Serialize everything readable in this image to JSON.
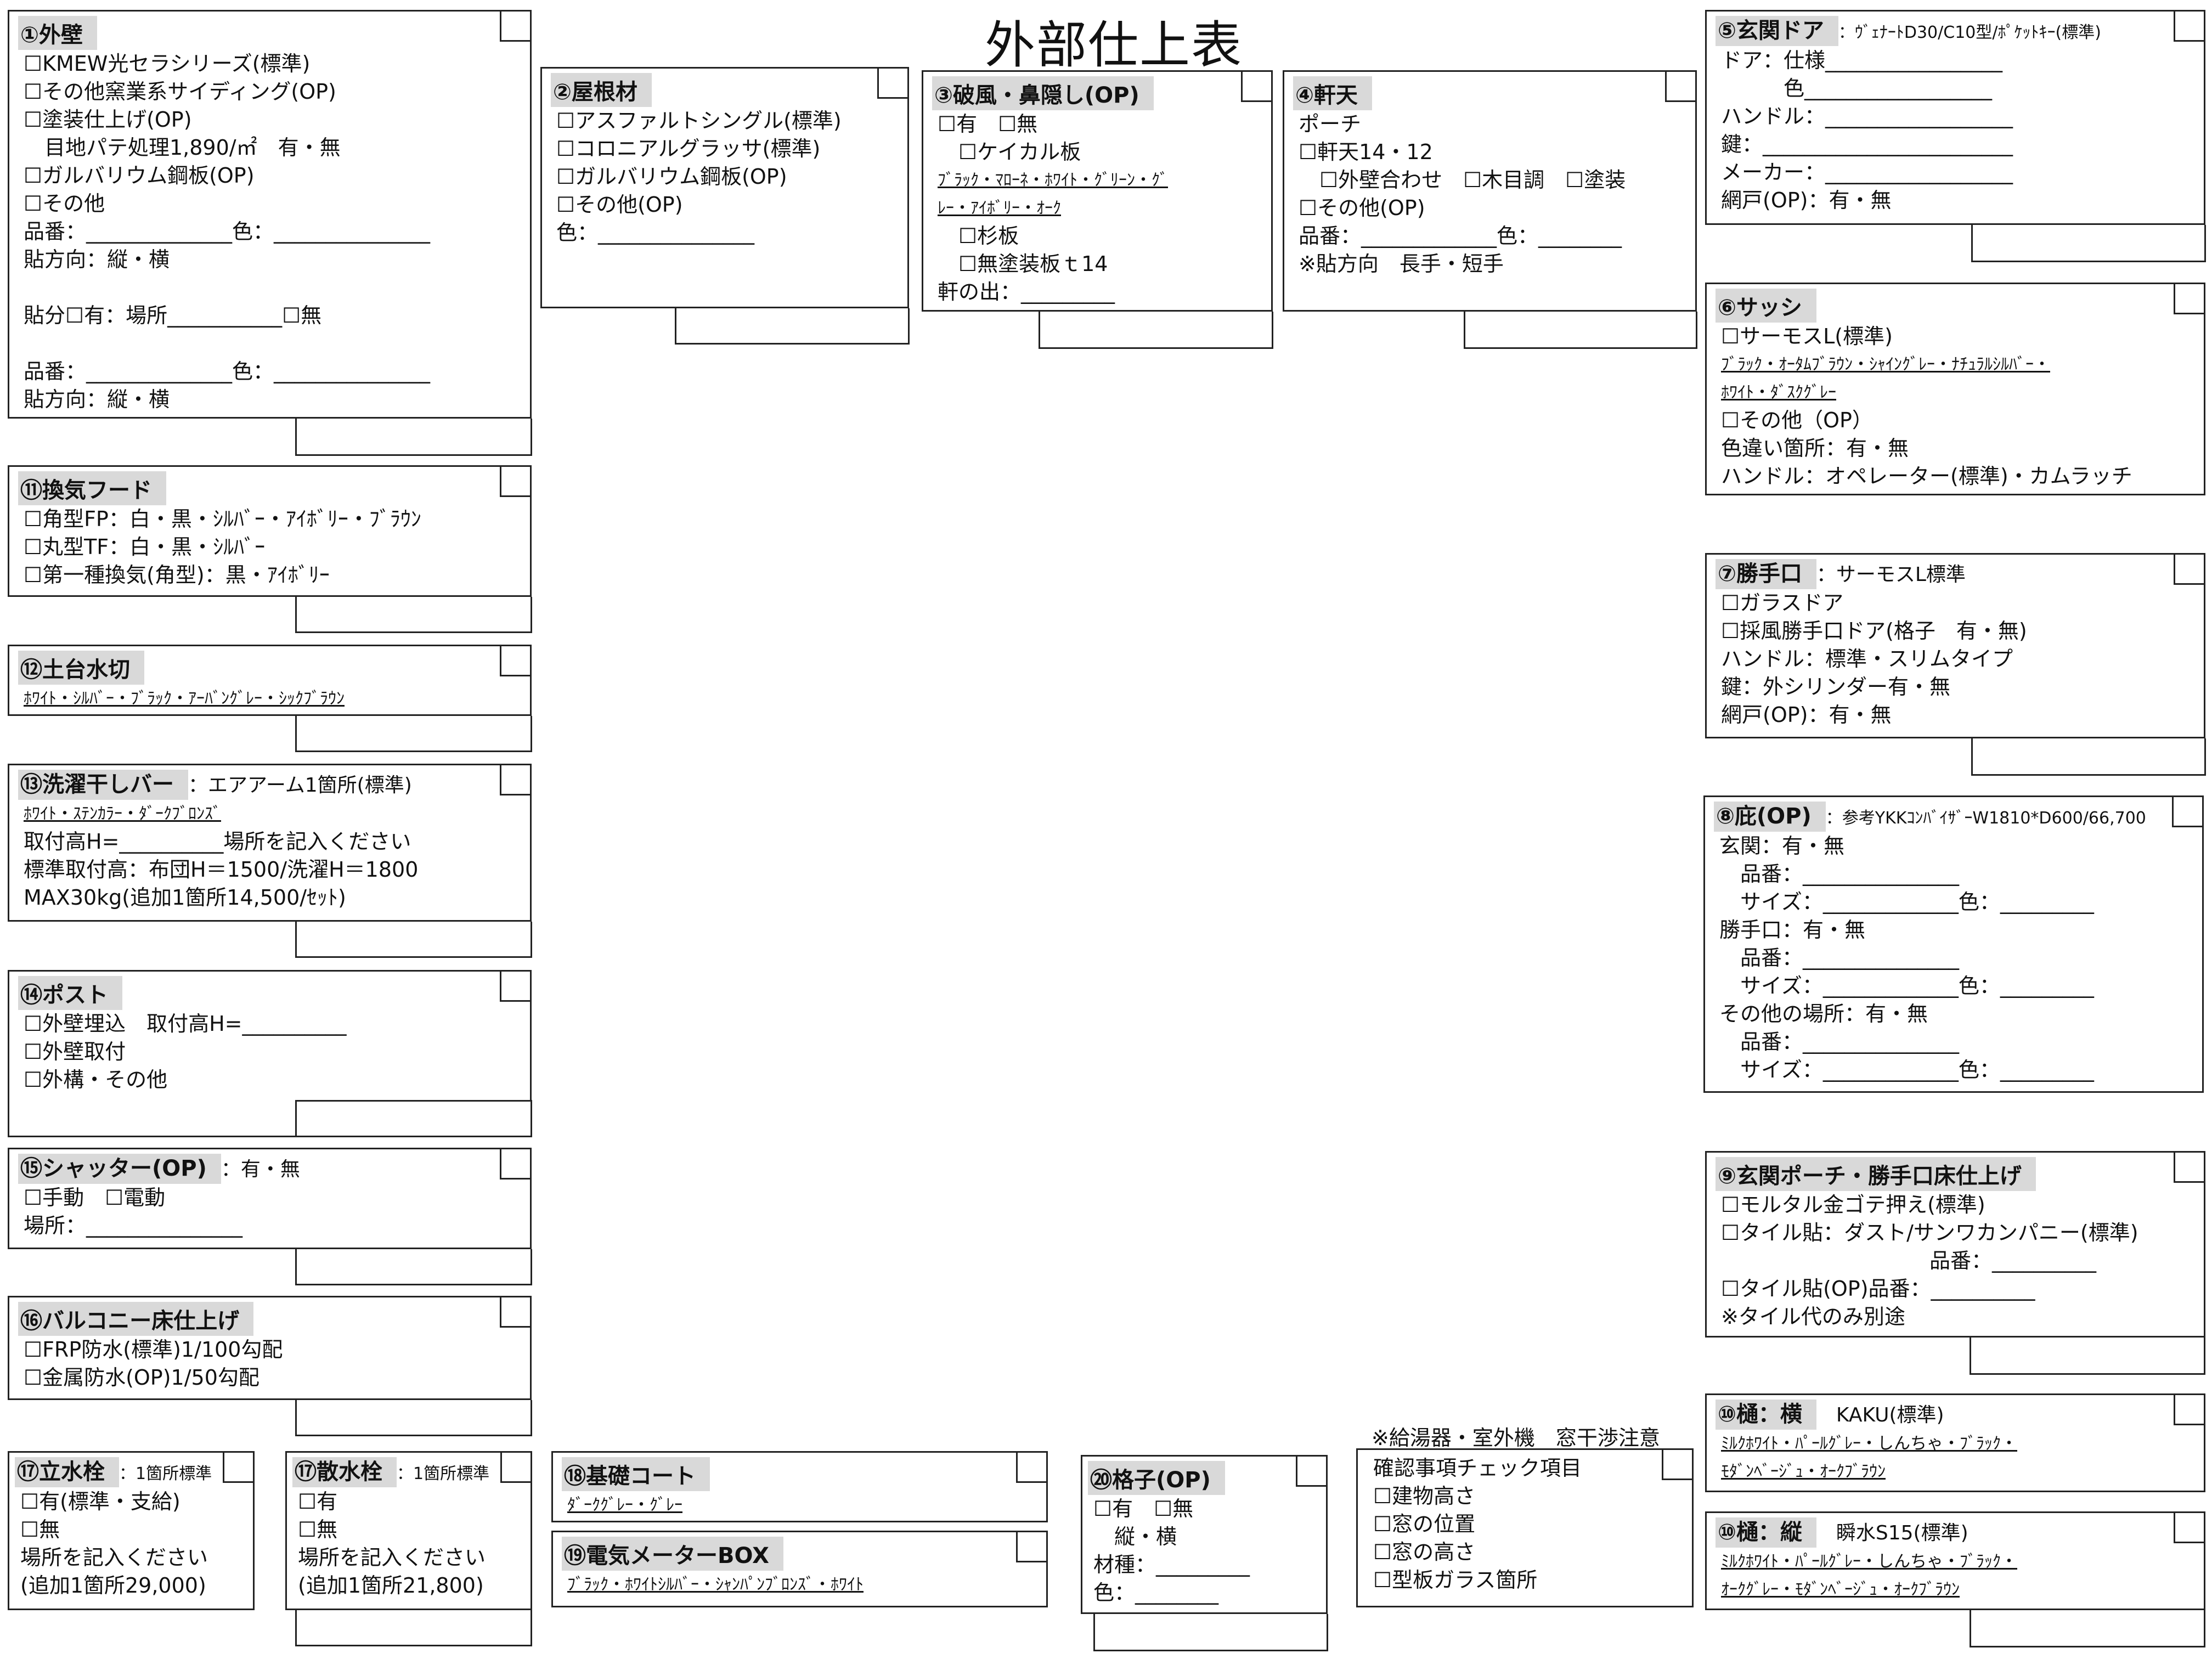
{
  "title": "外部仕上表",
  "note_top": "※給湯器・室外機　窓干渉注意",
  "sections": {
    "s1": {
      "head": "①外壁",
      "lines": [
        "☐KMEW光セラシリーズ(標準)",
        "☐その他窯業系サイディング(OP)",
        "☐塗装仕上げ(OP)",
        "　目地パテ処理1,890/㎡　有・無",
        "☐ガルバリウム鋼板(OP)",
        "☐その他",
        "品番：______________色：_______________",
        "貼方向：縦・横",
        "",
        "貼分☐有：場所___________☐無",
        "",
        "品番：______________色：_______________",
        "貼方向：縦・横"
      ]
    },
    "s2": {
      "head": "②屋根材",
      "lines": [
        "☐アスファルトシングル(標準)",
        "☐コロニアルグラッサ(標準)",
        "☐ガルバリウム鋼板(OP)",
        "☐その他(OP)",
        "色：_______________"
      ]
    },
    "s3": {
      "head": "③破風・鼻隠し(OP)",
      "lines": [
        "☐有　☐無",
        "　☐ケイカル板",
        "ﾌﾞﾗｯｸ・ﾏﾛｰﾈ・ﾎﾜｲﾄ・ｸﾞﾘｰﾝ・ｸﾞ",
        "ﾚｰ・ｱｲﾎﾞﾘｰ・ｵｰｸ",
        "　☐杉板",
        "　☐無塗装板ｔ14",
        "軒の出：_________"
      ]
    },
    "s4": {
      "head": "④軒天",
      "lines": [
        "ポーチ",
        "☐軒天14・12",
        "　☐外壁合わせ　☐木目調　☐塗装",
        "☐その他(OP)",
        "品番：_____________色：________",
        "※貼方向　長手・短手"
      ]
    },
    "s5": {
      "head": "⑤玄関ドア",
      "head_sub": "：ｳﾞｪﾅｰﾄD30/C10型/ﾎﾟｹｯﾄｷｰ(標準)",
      "lines": [
        "ドア：仕様_________________",
        "　　　色__________________",
        "ハンドル：__________________",
        "鍵：________________________",
        "メーカー：__________________",
        "網戸(OP)：有・無"
      ]
    },
    "s6": {
      "head": "⑥サッシ",
      "lines": [
        "☐サーモスL(標準)",
        "ﾌﾞﾗｯｸ・ｵｰﾀﾑﾌﾞﾗｳﾝ・ｼｬｲﾝｸﾞﾚｰ・ﾅﾁｭﾗﾙｼﾙﾊﾞｰ・",
        "ﾎﾜｲﾄ・ﾀﾞｽｸｸﾞﾚｰ",
        "☐その他（OP）",
        "色違い箇所：有・無",
        "ハンドル：オペレーター(標準)・カムラッチ"
      ]
    },
    "s7": {
      "head": "⑦勝手口",
      "head_sub": "：サーモスL標準",
      "lines": [
        "☐ガラスドア",
        "☐採風勝手口ドア(格子　有・無)",
        "ハンドル：標準・スリムタイプ",
        "鍵：外シリンダー有・無",
        "網戸(OP)：有・無"
      ]
    },
    "s8": {
      "head": "⑧庇(OP)",
      "head_sub": "：参考YKKｺﾝﾊﾞｲｻﾞｰW1810*D600/66,700",
      "lines": [
        "玄関：有・無",
        "　品番：_______________",
        "　サイズ：_____________色：_________",
        "勝手口：有・無",
        "　品番：_______________",
        "　サイズ：_____________色：_________",
        "その他の場所：有・無",
        "　品番：_______________",
        "　サイズ：_____________色：_________"
      ]
    },
    "s9": {
      "head": "⑨玄関ポーチ・勝手口床仕上げ",
      "lines": [
        "☐モルタル金ゴテ押え(標準)",
        "☐タイル貼：ダスト/サンワカンパニー(標準)",
        "　　　　　　　　　　品番：__________",
        "☐タイル貼(OP)品番：__________",
        "※タイル代のみ別途"
      ]
    },
    "s10a": {
      "head": "⑩樋：横",
      "head_sub": "　KAKU(標準)",
      "lines": [
        "ﾐﾙｸﾎﾜｲﾄ・ﾊﾟｰﾙｸﾞﾚｰ・しんちゃ・ﾌﾞﾗｯｸ・",
        "ﾓﾀﾞﾝﾍﾞｰｼﾞｭ・ｵｰｸﾌﾞﾗｳﾝ"
      ]
    },
    "s10b": {
      "head": "⑩樋：縦",
      "head_sub": "　瞬水S15(標準)",
      "lines": [
        "ﾐﾙｸﾎﾜｲﾄ・ﾊﾟｰﾙｸﾞﾚｰ・しんちゃ・ﾌﾞﾗｯｸ・",
        "ｵｰｸｸﾞﾚｰ・ﾓﾀﾞﾝﾍﾞｰｼﾞｭ・ｵｰｸﾌﾞﾗｳﾝ"
      ]
    },
    "s11": {
      "head": "⑪換気フード",
      "lines": [
        "☐角型FP：白・黒・ｼﾙﾊﾞｰ・ｱｲﾎﾞﾘｰ・ﾌﾞﾗｳﾝ",
        "☐丸型TF：白・黒・ｼﾙﾊﾞｰ",
        "☐第一種換気(角型)：黒・ｱｲﾎﾞﾘｰ"
      ]
    },
    "s12": {
      "head": "⑫土台水切",
      "lines": [
        "ﾎﾜｲﾄ・ｼﾙﾊﾞｰ・ﾌﾞﾗｯｸ・ｱｰﾊﾞﾝｸﾞﾚｰ・ｼｯｸﾌﾞﾗｳﾝ"
      ]
    },
    "s13": {
      "head": "⑬洗濯干しバー",
      "head_sub": "：エアアーム1箇所(標準)",
      "lines": [
        "ﾎﾜｲﾄ・ｽﾃﾝｶﾗｰ・ﾀﾞｰｸﾌﾞﾛﾝｽﾞ",
        "取付高H=__________場所を記入ください",
        "標準取付高：布団H＝1500/洗濯H＝1800",
        "MAX30kg(追加1箇所14,500/ｾｯﾄ)"
      ]
    },
    "s14": {
      "head": "⑭ポスト",
      "lines": [
        "☐外壁埋込　取付高H=__________",
        "☐外壁取付",
        "☐外構・その他"
      ]
    },
    "s15": {
      "head": "⑮シャッター(OP)",
      "head_sub": "：有・無",
      "lines": [
        "☐手動　☐電動",
        "場所：_______________"
      ]
    },
    "s16": {
      "head": "⑯バルコニー床仕上げ",
      "lines": [
        "☐FRP防水(標準)1/100勾配",
        "☐金属防水(OP)1/50勾配"
      ]
    },
    "s17": {
      "head": "⑰立水栓",
      "head_sub": "：1箇所標準",
      "lines": [
        "☐有(標準・支給)",
        "☐無",
        "場所を記入ください",
        "(追加1箇所29,000)"
      ]
    },
    "s17b": {
      "head": "⑰散水栓",
      "head_sub": "：1箇所標準",
      "lines": [
        "☐有",
        "☐無",
        "場所を記入ください",
        "(追加1箇所21,800)"
      ]
    },
    "s18": {
      "head": "⑱基礎コート",
      "lines": [
        "ﾀﾞｰｸｸﾞﾚｰ・ｸﾞﾚｰ"
      ]
    },
    "s19": {
      "head": "⑲電気メーターBOX",
      "lines": [
        "ﾌﾞﾗｯｸ・ﾎﾜｲﾄｼﾙﾊﾞｰ・ｼｬﾝﾊﾟﾝﾌﾞﾛﾝｽﾞ・ﾎﾜｲﾄ"
      ]
    },
    "s20": {
      "head": "⑳格子(OP)",
      "lines": [
        "☐有　☐無",
        "　縦・横",
        "材種：_________",
        "色：________"
      ]
    },
    "check": {
      "lines": [
        "確認事項チェック項目",
        "☐建物高さ",
        "☐窓の位置",
        "☐窓の高さ",
        "☐型板ガラス箇所"
      ]
    }
  }
}
